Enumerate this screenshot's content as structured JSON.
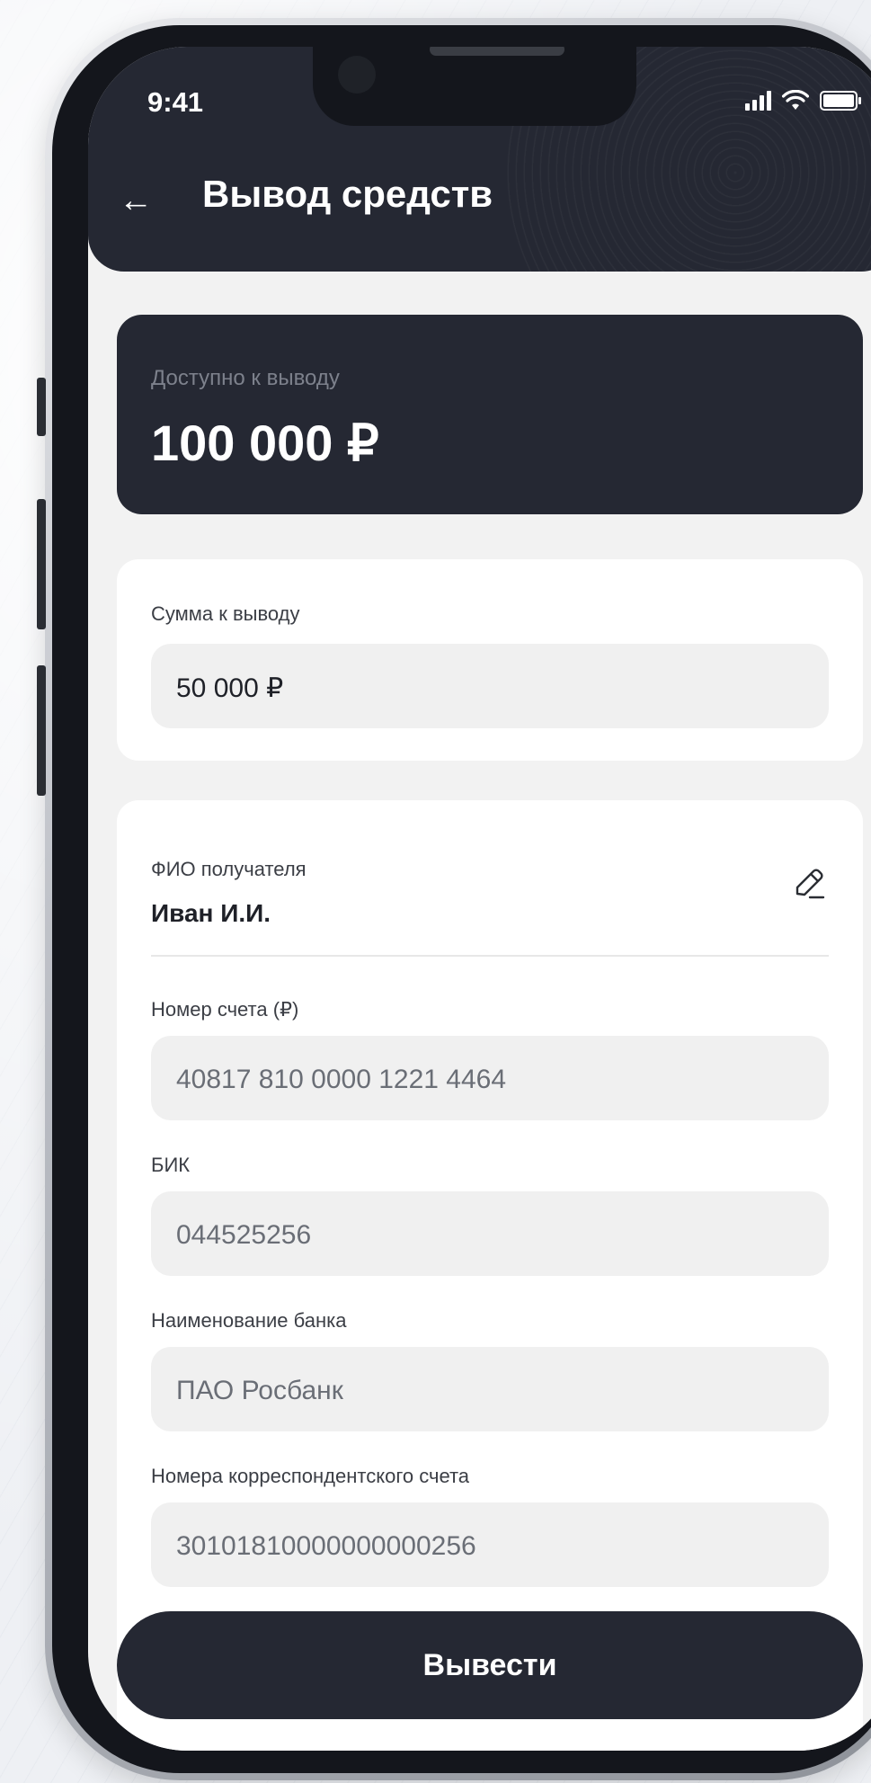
{
  "status_bar": {
    "time": "9:41"
  },
  "header": {
    "title": "Вывод средств"
  },
  "balance": {
    "label": "Доступно к выводу",
    "value": "100 000 ₽"
  },
  "amount": {
    "label": "Сумма к выводу",
    "value": "50 000 ₽"
  },
  "recipient": {
    "label": "ФИО получателя",
    "name": "Иван И.И."
  },
  "account": {
    "label": "Номер счета (₽)",
    "value": "40817 810 0000 1221 4464"
  },
  "bik": {
    "label": "БИК",
    "value": "044525256"
  },
  "bank": {
    "label": "Наименование банка",
    "value": "ПАО Росбанк"
  },
  "corr_account": {
    "label": "Номера корреспондентского счета",
    "value": "30101810000000000256"
  },
  "submit": {
    "label": "Вывести"
  },
  "icons": {
    "back": "arrow-left-icon",
    "edit": "pencil-icon",
    "signal": "signal-icon",
    "wifi": "wifi-icon",
    "battery": "battery-icon"
  },
  "colors": {
    "dark": "#252833",
    "background": "#f2f2f2",
    "card": "#ffffff",
    "field": "#f0f0f0"
  }
}
